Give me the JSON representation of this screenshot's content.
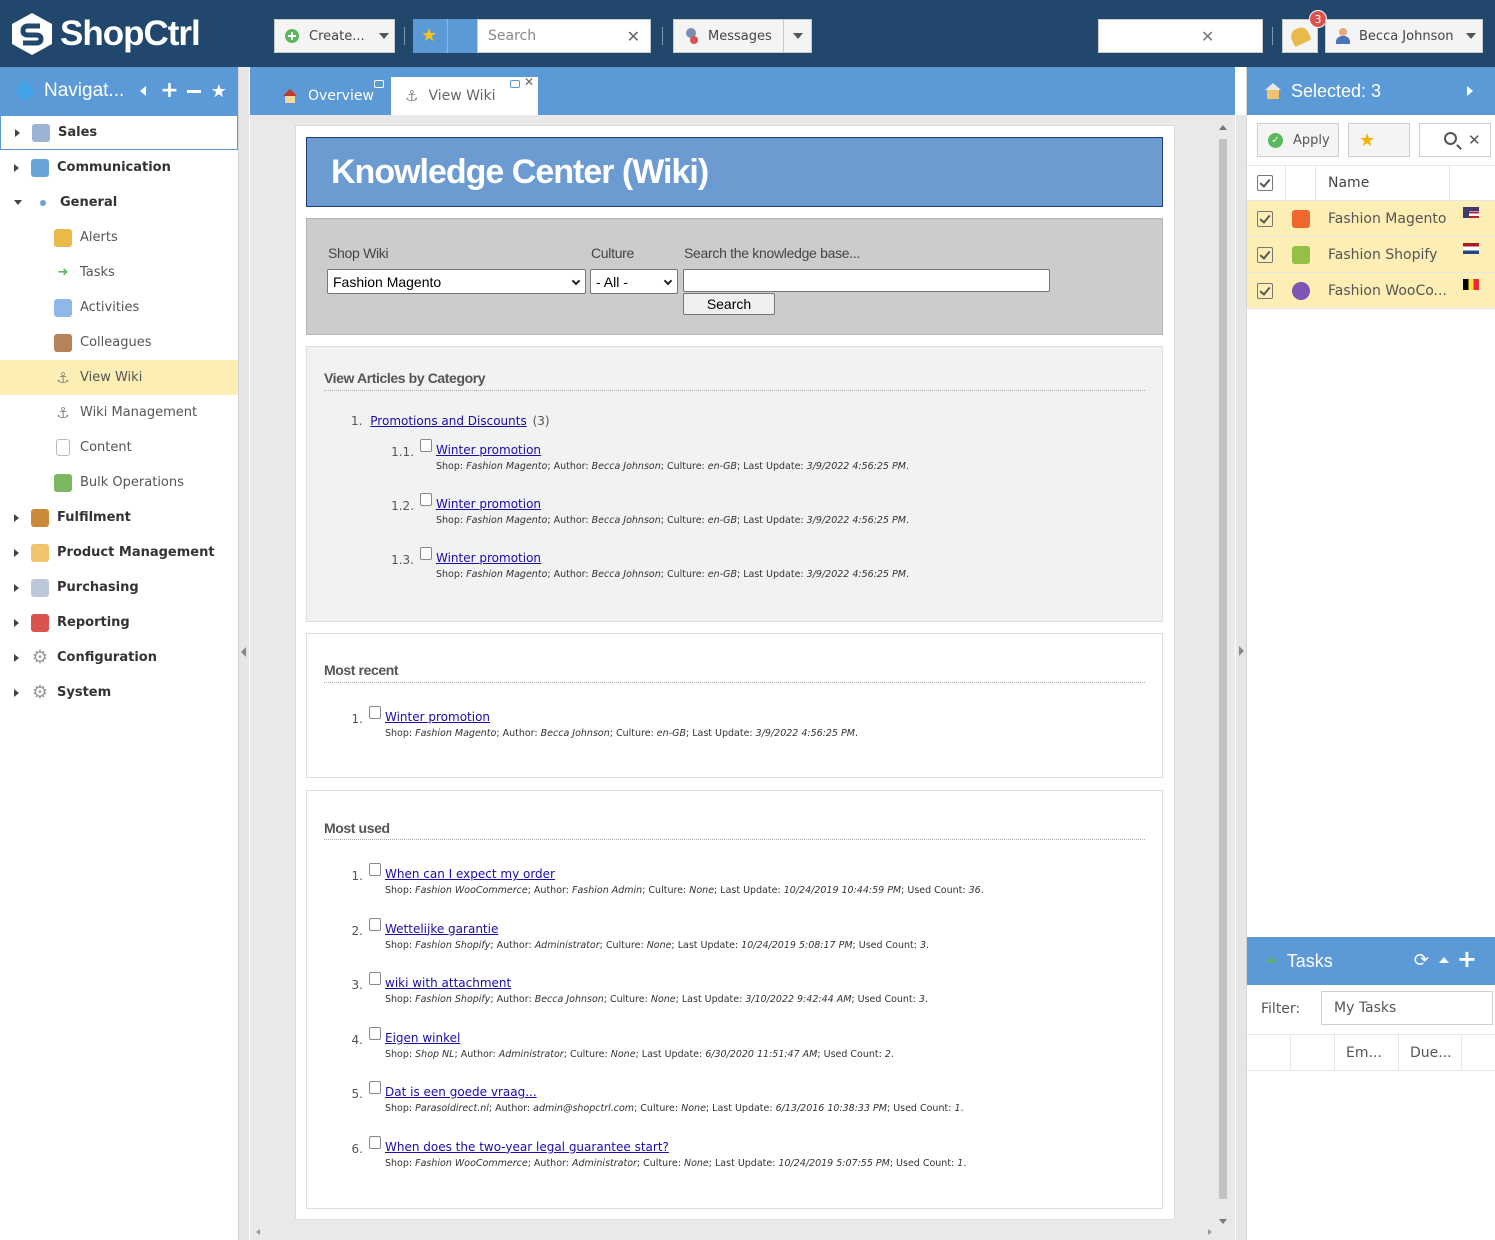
{
  "app": {
    "logo_text": "ShopCtrl"
  },
  "topbar": {
    "create_label": "Create...",
    "search_placeholder": "Search",
    "messages_label": "Messages",
    "notifications_count": "3",
    "user_name": "Becca Johnson"
  },
  "nav": {
    "title": "Navigat...",
    "items": [
      {
        "label": "Sales",
        "level": "top",
        "icon": "sales-icon"
      },
      {
        "label": "Communication",
        "level": "top",
        "icon": "chat-icon"
      },
      {
        "label": "General",
        "level": "top",
        "icon": "dot-icon"
      },
      {
        "label": "Alerts",
        "level": "sub",
        "icon": "bell-icon"
      },
      {
        "label": "Tasks",
        "level": "sub",
        "icon": "arrow-icon"
      },
      {
        "label": "Activities",
        "level": "sub",
        "icon": "notepad-icon"
      },
      {
        "label": "Colleagues",
        "level": "sub",
        "icon": "person-icon"
      },
      {
        "label": "View Wiki",
        "level": "sub",
        "icon": "anchor-icon"
      },
      {
        "label": "Wiki Management",
        "level": "sub",
        "icon": "anchor-icon"
      },
      {
        "label": "Content",
        "level": "sub",
        "icon": "document-icon"
      },
      {
        "label": "Bulk Operations",
        "level": "sub",
        "icon": "boxes-icon"
      },
      {
        "label": "Fulfilment",
        "level": "top",
        "icon": "box-icon"
      },
      {
        "label": "Product Management",
        "level": "top",
        "icon": "cube-icon"
      },
      {
        "label": "Purchasing",
        "level": "top",
        "icon": "cart-icon"
      },
      {
        "label": "Reporting",
        "level": "top",
        "icon": "report-icon"
      },
      {
        "label": "Configuration",
        "level": "top",
        "icon": "gear-icon"
      },
      {
        "label": "System",
        "level": "top",
        "icon": "gear-icon"
      }
    ]
  },
  "tabs": [
    {
      "label": "Overview"
    },
    {
      "label": "View Wiki"
    }
  ],
  "wiki": {
    "title": "Knowledge Center (Wiki)",
    "shop_label": "Shop Wiki",
    "shop_value": "Fashion Magento",
    "culture_label": "Culture",
    "culture_value": "- All -",
    "search_label": "Search the knowledge base...",
    "search_value": "",
    "search_button": "Search",
    "category_heading": "View Articles by Category",
    "category": {
      "num": "1.",
      "name": "Promotions and Discounts",
      "count": "(3)"
    },
    "category_articles": [
      {
        "num": "1.1.",
        "title": "Winter promotion",
        "shop": "Fashion Magento",
        "author": "Becca Johnson",
        "culture": "en-GB",
        "updated": "3/9/2022 4:56:25 PM"
      },
      {
        "num": "1.2.",
        "title": "Winter promotion",
        "shop": "Fashion Magento",
        "author": "Becca Johnson",
        "culture": "en-GB",
        "updated": "3/9/2022 4:56:25 PM"
      },
      {
        "num": "1.3.",
        "title": "Winter promotion",
        "shop": "Fashion Magento",
        "author": "Becca Johnson",
        "culture": "en-GB",
        "updated": "3/9/2022 4:56:25 PM"
      }
    ],
    "recent_heading": "Most recent",
    "recent_articles": [
      {
        "num": "1.",
        "title": "Winter promotion",
        "shop": "Fashion Magento",
        "author": "Becca Johnson",
        "culture": "en-GB",
        "updated": "3/9/2022 4:56:25 PM"
      }
    ],
    "used_heading": "Most used",
    "used_articles": [
      {
        "num": "1.",
        "title": "When can I expect my order",
        "shop": "Fashion WooCommerce",
        "author": "Fashion Admin",
        "culture": "None",
        "updated": "10/24/2019 10:44:59 PM",
        "used": "36"
      },
      {
        "num": "2.",
        "title": "Wettelijke garantie",
        "shop": "Fashion Shopify",
        "author": "Administrator",
        "culture": "None",
        "updated": "10/24/2019 5:08:17 PM",
        "used": "3"
      },
      {
        "num": "3.",
        "title": "wiki with attachment",
        "shop": "Fashion Shopify",
        "author": "Becca Johnson",
        "culture": "None",
        "updated": "3/10/2022 9:42:44 AM",
        "used": "3"
      },
      {
        "num": "4.",
        "title": "Eigen winkel",
        "shop": "Shop NL",
        "author": "Administrator",
        "culture": "None",
        "updated": "6/30/2020 11:51:47 AM",
        "used": "2"
      },
      {
        "num": "5.",
        "title": "Dat is een goede vraag...",
        "shop": "Parasoldirect.nl",
        "author": "admin@shopctrl.com",
        "culture": "None",
        "updated": "6/13/2016 10:38:33 PM",
        "used": "1"
      },
      {
        "num": "6.",
        "title": "When does the two-year legal guarantee start?",
        "shop": "Fashion WooCommerce",
        "author": "Administrator",
        "culture": "None",
        "updated": "10/24/2019 5:07:55 PM",
        "used": "1"
      }
    ],
    "meta_labels": {
      "shop": "Shop:",
      "author": "Author:",
      "culture": "Culture:",
      "updated": "Last Update:",
      "used": "Used Count:"
    }
  },
  "selected": {
    "title": "Selected: 3",
    "apply_label": "Apply",
    "name_header": "Name",
    "shops": [
      {
        "name": "Fashion Magento",
        "platform": "magento-icon",
        "flag": "us-flag-icon"
      },
      {
        "name": "Fashion Shopify",
        "platform": "shopify-icon",
        "flag": "nl-flag-icon"
      },
      {
        "name": "Fashion WooCo...",
        "platform": "woocommerce-icon",
        "flag": "be-flag-icon"
      }
    ]
  },
  "tasks": {
    "title": "Tasks",
    "filter_label": "Filter:",
    "filter_value": "My Tasks",
    "col_em": "Em...",
    "col_due": "Due..."
  },
  "colors": {
    "topbar": "#21476d",
    "header_blue": "#5b9ad6",
    "highlight": "#fceeb4",
    "wiki_title_bg": "#6b9bd1"
  }
}
